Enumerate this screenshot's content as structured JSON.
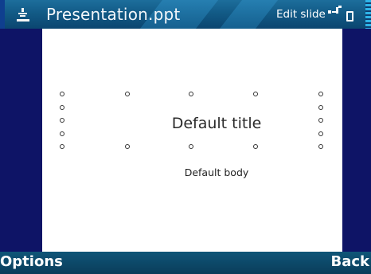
{
  "titlebar": {
    "app_icon": "presentation-doc-icon",
    "title": "Presentation.ppt",
    "status": "Edit slide",
    "signal_icon": "signal-connection-icon",
    "battery_icon": "battery-icon"
  },
  "slide": {
    "title_placeholder": "Default title",
    "body_placeholder": "Default body"
  },
  "softkeys": {
    "left": "Options",
    "right": "Back"
  }
}
